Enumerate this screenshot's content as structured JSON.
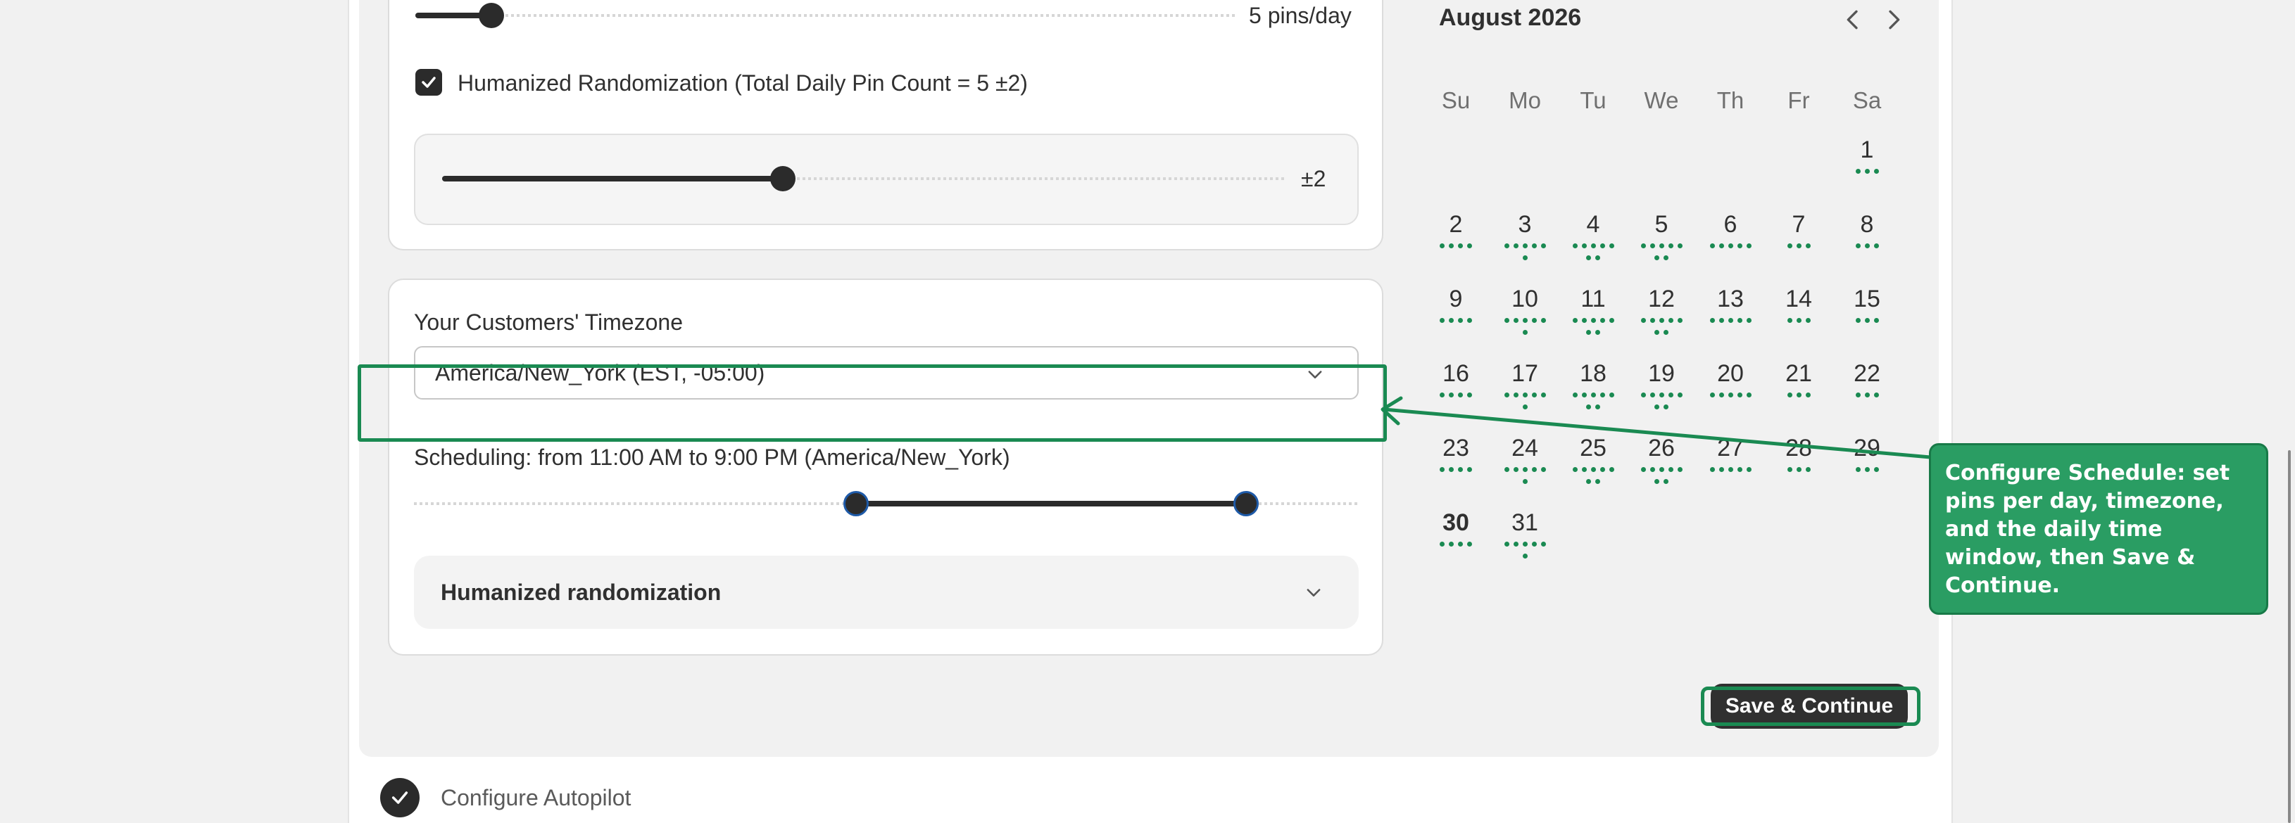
{
  "pins_slider": {
    "value_label": "5 pins/day",
    "value_fraction": 0.09
  },
  "randomization_checkbox": {
    "checked": true,
    "label": "Humanized Randomization (Total Daily Pin Count = 5 ±2)"
  },
  "variance_slider": {
    "value_label": "±2",
    "value_fraction": 0.4
  },
  "timezone": {
    "label": "Your Customers' Timezone",
    "value": "America/New_York (EST, -05:00)"
  },
  "scheduling": {
    "label": "Scheduling: from 11:00 AM to 9:00 PM (America/New_York)",
    "range_start_fraction": 0.47,
    "range_end_fraction": 0.885
  },
  "humanized_section": {
    "label": "Humanized randomization"
  },
  "calendar": {
    "title": "August 2026",
    "weekdays": [
      "Su",
      "Mo",
      "Tu",
      "We",
      "Th",
      "Fr",
      "Sa"
    ],
    "days": [
      {
        "d": "1",
        "dots": [
          3
        ]
      },
      {
        "d": "2",
        "dots": [
          4
        ]
      },
      {
        "d": "3",
        "dots": [
          5,
          1
        ]
      },
      {
        "d": "4",
        "dots": [
          5,
          2
        ]
      },
      {
        "d": "5",
        "dots": [
          5,
          2
        ]
      },
      {
        "d": "6",
        "dots": [
          5
        ]
      },
      {
        "d": "7",
        "dots": [
          3
        ]
      },
      {
        "d": "8",
        "dots": [
          3
        ]
      },
      {
        "d": "9",
        "dots": [
          4
        ]
      },
      {
        "d": "10",
        "dots": [
          5,
          1
        ]
      },
      {
        "d": "11",
        "dots": [
          5,
          2
        ]
      },
      {
        "d": "12",
        "dots": [
          5,
          2
        ]
      },
      {
        "d": "13",
        "dots": [
          5
        ]
      },
      {
        "d": "14",
        "dots": [
          3
        ]
      },
      {
        "d": "15",
        "dots": [
          3
        ]
      },
      {
        "d": "16",
        "dots": [
          4
        ]
      },
      {
        "d": "17",
        "dots": [
          5,
          1
        ]
      },
      {
        "d": "18",
        "dots": [
          5,
          2
        ]
      },
      {
        "d": "19",
        "dots": [
          5,
          2
        ]
      },
      {
        "d": "20",
        "dots": [
          5
        ]
      },
      {
        "d": "21",
        "dots": [
          3
        ]
      },
      {
        "d": "22",
        "dots": [
          3
        ]
      },
      {
        "d": "23",
        "dots": [
          4
        ]
      },
      {
        "d": "24",
        "dots": [
          5,
          1
        ]
      },
      {
        "d": "25",
        "dots": [
          5,
          2
        ]
      },
      {
        "d": "26",
        "dots": [
          5,
          2
        ]
      },
      {
        "d": "27",
        "dots": [
          5
        ]
      },
      {
        "d": "28",
        "dots": [
          3
        ]
      },
      {
        "d": "29",
        "dots": [
          3
        ]
      },
      {
        "d": "30",
        "dots": [
          4
        ],
        "bold": true
      },
      {
        "d": "31",
        "dots": [
          5,
          1
        ]
      }
    ]
  },
  "save_button": {
    "label": "Save & Continue"
  },
  "callout": {
    "text": "Configure Schedule: set pins per day, timezone, and the daily time window, then Save & Continue."
  },
  "step": {
    "label": "Configure Autopilot"
  },
  "colors": {
    "accent": "#1a8a52",
    "callout_bg": "#2a9d63",
    "primary": "#303030"
  }
}
